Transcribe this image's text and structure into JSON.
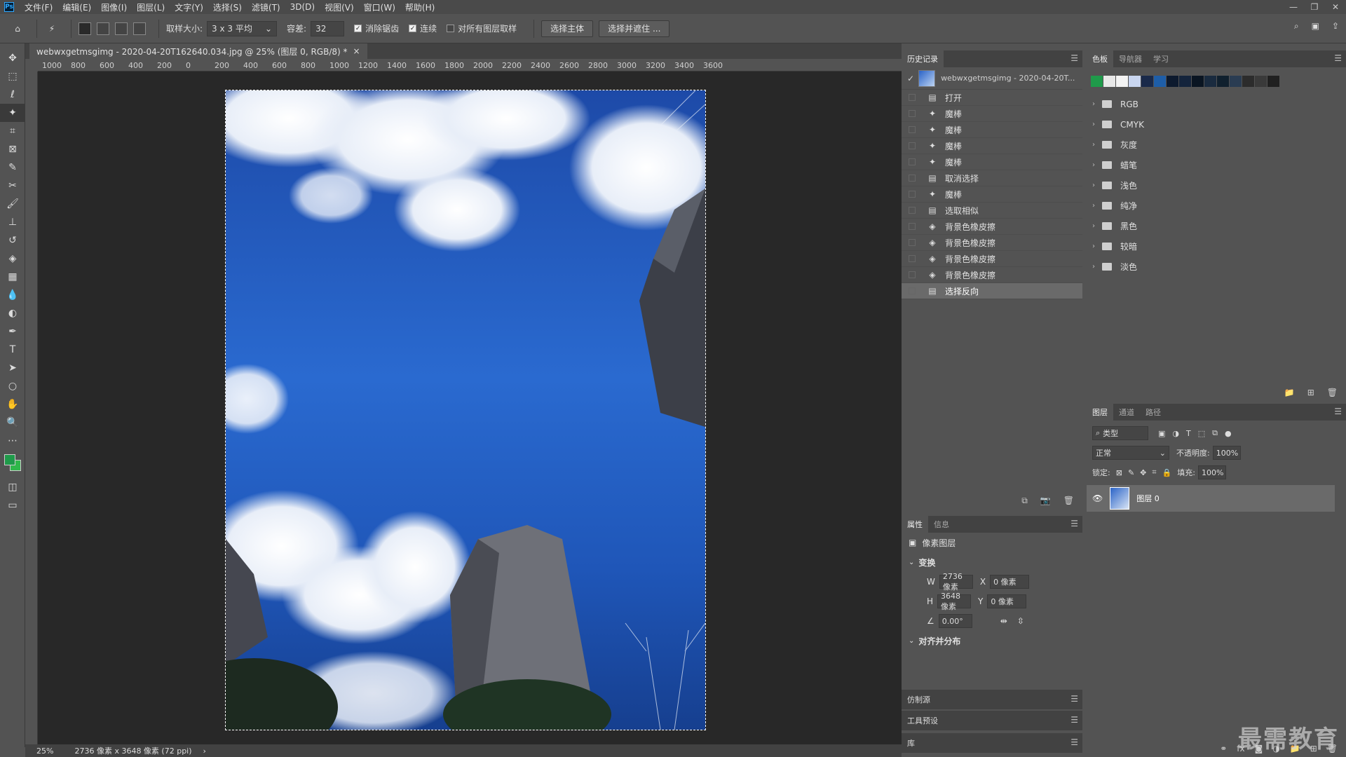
{
  "app": {
    "logo": "Ps",
    "menu": [
      "文件(F)",
      "编辑(E)",
      "图像(I)",
      "图层(L)",
      "文字(Y)",
      "选择(S)",
      "滤镜(T)",
      "3D(D)",
      "视图(V)",
      "窗口(W)",
      "帮助(H)"
    ],
    "window_controls": [
      "—",
      "❐",
      "✕"
    ]
  },
  "options": {
    "sample_size_label": "取样大小:",
    "sample_size_value": "3 x 3 平均",
    "tolerance_label": "容差:",
    "tolerance_value": "32",
    "anti_alias": "消除锯齿",
    "contiguous": "连续",
    "sample_all_layers": "对所有图层取样",
    "select_subject": "选择主体",
    "select_and_mask": "选择并遮住 ..."
  },
  "document": {
    "tab_title": "webwxgetmsgimg - 2020-04-20T162640.034.jpg @ 25% (图层 0, RGB/8) *",
    "tab_close": "×",
    "zoom": "25%",
    "status": "2736 像素 x 3648 像素 (72 ppi)",
    "status_arrow": "›",
    "ruler_h": [
      "1000",
      "800",
      "600",
      "400",
      "200",
      "0",
      "200",
      "400",
      "600",
      "800",
      "1000",
      "1200",
      "1400",
      "1600",
      "1800",
      "2000",
      "2200",
      "2400",
      "2600",
      "2800",
      "3000",
      "3200",
      "3400",
      "3600"
    ]
  },
  "history": {
    "tabs": [
      "历史记录"
    ],
    "snapshot": "webwxgetmsgimg - 2020-04-20T...",
    "items": [
      {
        "label": "打开",
        "icon": "doc-icon"
      },
      {
        "label": "魔棒",
        "icon": "wand-icon"
      },
      {
        "label": "魔棒",
        "icon": "wand-icon"
      },
      {
        "label": "魔棒",
        "icon": "wand-icon"
      },
      {
        "label": "魔棒",
        "icon": "wand-icon"
      },
      {
        "label": "取消选择",
        "icon": "doc-icon"
      },
      {
        "label": "魔棒",
        "icon": "wand-icon"
      },
      {
        "label": "选取相似",
        "icon": "doc-icon"
      },
      {
        "label": "背景色橡皮擦",
        "icon": "eraser-icon"
      },
      {
        "label": "背景色橡皮擦",
        "icon": "eraser-icon"
      },
      {
        "label": "背景色橡皮擦",
        "icon": "eraser-icon"
      },
      {
        "label": "背景色橡皮擦",
        "icon": "eraser-icon"
      },
      {
        "label": "选择反向",
        "icon": "doc-icon",
        "selected": true
      }
    ]
  },
  "properties": {
    "tabs": [
      "属性",
      "信息"
    ],
    "type": "像素图层",
    "transform_title": "变换",
    "w_label": "W",
    "w_value": "2736 像素",
    "x_label": "X",
    "x_value": "0 像素",
    "h_label": "H",
    "h_value": "3648 像素",
    "y_label": "Y",
    "y_value": "0 像素",
    "angle": "0.00°",
    "align_title": "对齐并分布"
  },
  "collapsed_panels": [
    "仿制源",
    "工具预设",
    "库"
  ],
  "swatches": {
    "tabs": [
      "色板",
      "导航器",
      "学习"
    ],
    "colors": [
      "#1f9a4a",
      "#e8e8e8",
      "#f4f4f4",
      "#c9d6f0",
      "#1a2a4a",
      "#1e5ea8",
      "#0d1a2e",
      "#14243c",
      "#0a1522",
      "#1a2b3f",
      "#10202e",
      "#2a3c52",
      "#2c2c2c",
      "#3a3a3a",
      "#202020"
    ],
    "groups": [
      "RGB",
      "CMYK",
      "灰度",
      "蜡笔",
      "浅色",
      "纯净",
      "黑色",
      "较暗",
      "淡色"
    ]
  },
  "layers": {
    "tabs": [
      "图层",
      "通道",
      "路径"
    ],
    "filter": "类型",
    "blend_mode": "正常",
    "opacity_label": "不透明度:",
    "opacity_value": "100%",
    "lock_label": "锁定:",
    "fill_label": "填充:",
    "fill_value": "100%",
    "layer_name": "图层 0"
  },
  "watermark": "最需教育"
}
